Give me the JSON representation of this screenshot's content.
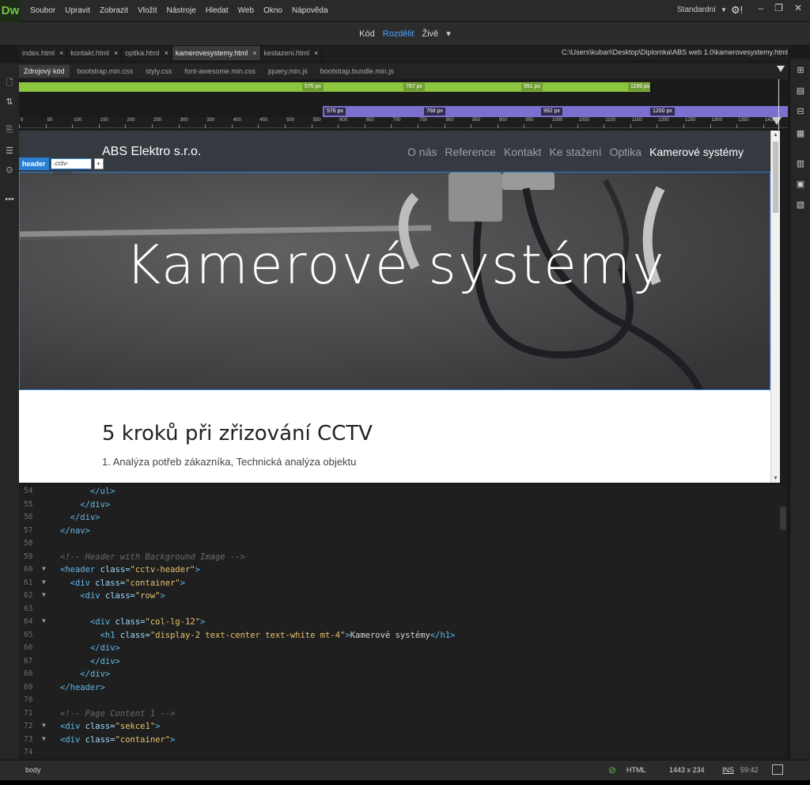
{
  "app": {
    "logo": "Dw",
    "workspace": "Standardní",
    "gear": "⚙!"
  },
  "menu": [
    "Soubor",
    "Upravit",
    "Zobrazit",
    "Vložit",
    "Nástroje",
    "Hledat",
    "Web",
    "Okno",
    "Nápověda"
  ],
  "views": {
    "code": "Kód",
    "split": "Rozdělit",
    "live": "Živě"
  },
  "tabs": [
    {
      "label": "index.html",
      "active": false
    },
    {
      "label": "kontakt.html",
      "active": false
    },
    {
      "label": "optika.html",
      "active": false
    },
    {
      "label": "kamerovesystemy.html",
      "active": true
    },
    {
      "label": "kestazeni.html",
      "active": false
    }
  ],
  "filepath": "C:\\Users\\kubari\\Desktop\\Diplomka\\ABS web 1.0\\kamerovesystemy.html",
  "related_files": [
    "Zdrojový kód",
    "bootstrap.min.css",
    "styly.css",
    "font-awesome.min.css",
    "jquery.min.js",
    "bootstrap.bundle.min.js"
  ],
  "media_queries_min": [
    "575 px",
    "767 px",
    "991 px",
    "1199 px"
  ],
  "media_queries_max": [
    "576 px",
    "768 px",
    "992 px",
    "1200 px"
  ],
  "ruler_labels": [
    "0",
    "50",
    "100",
    "150",
    "200",
    "250",
    "300",
    "350",
    "400",
    "450",
    "500",
    "550",
    "600",
    "650",
    "700",
    "750",
    "800",
    "850",
    "900",
    "950",
    "1000",
    "1050",
    "1100",
    "1150",
    "1200",
    "1250",
    "1300",
    "1350",
    "1400"
  ],
  "live": {
    "brand": "ABS Elektro s.r.o.",
    "nav": [
      "O nás",
      "Reference",
      "Kontakt",
      "Ke stažení",
      "Optika",
      "Kamerové systémy"
    ],
    "selected_tag": "header",
    "selected_class": ".cctv-header",
    "plus": "+",
    "hero_title": "Kamerové systémy",
    "section_title": "5 kroků při zřizování CCTV",
    "section_sub": "1. Analýza potřeb zákazníka, Technická analýza objektu"
  },
  "code_lines": [
    {
      "n": "54",
      "fold": "",
      "html": "      </ul>"
    },
    {
      "n": "55",
      "fold": "",
      "html": "    </div>"
    },
    {
      "n": "56",
      "fold": "",
      "html": "  </div>"
    },
    {
      "n": "57",
      "fold": "",
      "html": "</nav>"
    },
    {
      "n": "58",
      "fold": "",
      "html": ""
    },
    {
      "n": "59",
      "fold": "",
      "html": "<!-- Header with Background Image -->"
    },
    {
      "n": "60",
      "fold": "▼",
      "html": "<header class=\"cctv-header\">"
    },
    {
      "n": "61",
      "fold": "▼",
      "html": "  <div class=\"container\">"
    },
    {
      "n": "62",
      "fold": "▼",
      "html": "    <div class=\"row\">"
    },
    {
      "n": "63",
      "fold": "",
      "html": ""
    },
    {
      "n": "64",
      "fold": "▼",
      "html": "      <div class=\"col-lg-12\">"
    },
    {
      "n": "65",
      "fold": "",
      "html": "        <h1 class=\"display-2 text-center text-white mt-4\">Kamerové systémy</h1>"
    },
    {
      "n": "66",
      "fold": "",
      "html": "      </div>"
    },
    {
      "n": "67",
      "fold": "",
      "html": "      </div>"
    },
    {
      "n": "68",
      "fold": "",
      "html": "    </div>"
    },
    {
      "n": "69",
      "fold": "",
      "html": "</header>"
    },
    {
      "n": "70",
      "fold": "",
      "html": ""
    },
    {
      "n": "71",
      "fold": "",
      "html": "<!-- Page Content 1 -->"
    },
    {
      "n": "72",
      "fold": "▼",
      "html": "<div class=\"sekce1\">"
    },
    {
      "n": "73",
      "fold": "▼",
      "html": "<div class=\"container\">"
    },
    {
      "n": "74",
      "fold": "",
      "html": ""
    }
  ],
  "status": {
    "crumb": "body",
    "language": "HTML",
    "size": "1443 x 234",
    "ins": "INS",
    "position": "59:42"
  }
}
